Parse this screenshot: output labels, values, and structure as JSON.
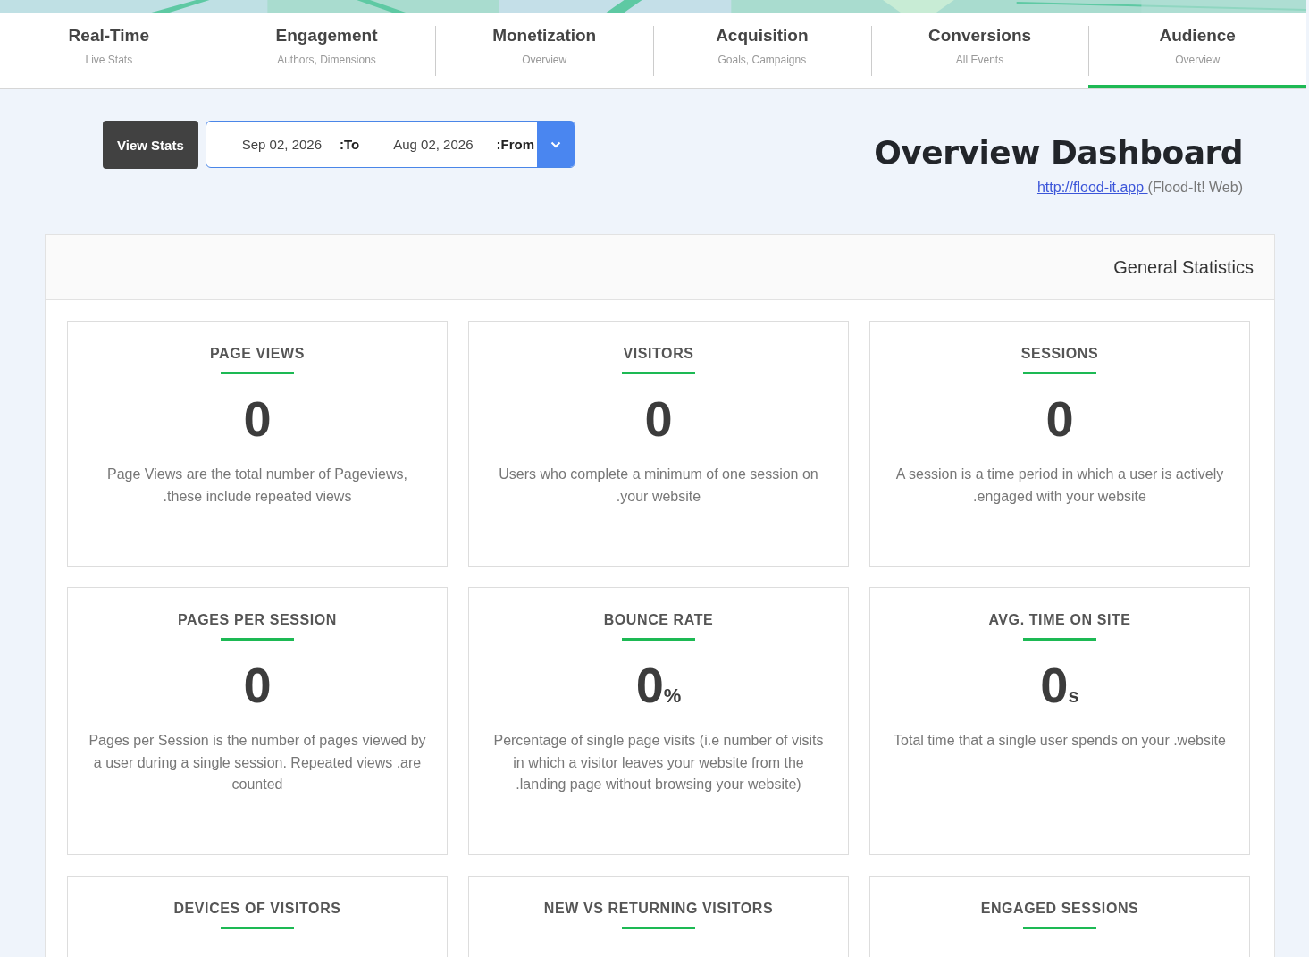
{
  "tabs": [
    {
      "label": "Real-Time",
      "sub": "Live Stats",
      "selected": false,
      "divider": false
    },
    {
      "label": "Engagement",
      "sub": "Authors, Dimensions",
      "selected": false,
      "divider": false
    },
    {
      "label": "Monetization",
      "sub": "Overview",
      "selected": false,
      "divider": true
    },
    {
      "label": "Acquisition",
      "sub": "Goals, Campaigns",
      "selected": false,
      "divider": true
    },
    {
      "label": "Conversions",
      "sub": "All Events",
      "selected": false,
      "divider": true
    },
    {
      "label": "Audience",
      "sub": "Overview",
      "selected": true,
      "divider": true
    }
  ],
  "view_button": "View Stats",
  "date_range": {
    "to_value": "Sep 02, 2026",
    "to_label": ":To",
    "from_value": "Aug 02, 2026",
    "from_label": ":From"
  },
  "title": "Overview Dashboard",
  "site": {
    "link": "http://flood-it.app ",
    "name": "(Flood-It! Web)"
  },
  "panel": {
    "title": "General Statistics",
    "cards": [
      {
        "title": "PAGE VIEWS",
        "value": "0",
        "description": "Page Views are the total number of Pageviews, .these include repeated views"
      },
      {
        "title": "VISITORS",
        "value": "0",
        "description": "Users who complete a minimum of one session on .your website"
      },
      {
        "title": "SESSIONS",
        "value": "0",
        "description": "A session is a time period in which a user is actively .engaged with your website"
      },
      {
        "title": "PAGES PER SESSION",
        "value": "0",
        "description": "Pages per Session is the number of pages viewed by a user during a single session. Repeated views .are counted"
      },
      {
        "title": "BOUNCE RATE",
        "value": "0",
        "unit": "%",
        "description": "Percentage of single page visits (i.e number of visits in which a visitor leaves your website from the .landing page without browsing your website)"
      },
      {
        "title": "AVG. TIME ON SITE",
        "value": "0",
        "unit": "s",
        "description": "Total time that a single user spends on your .website"
      },
      {
        "title": "DEVICES OF VISITORS"
      },
      {
        "title": "NEW VS RETURNING VISITORS"
      },
      {
        "title": "ENGAGED SESSIONS"
      }
    ]
  }
}
